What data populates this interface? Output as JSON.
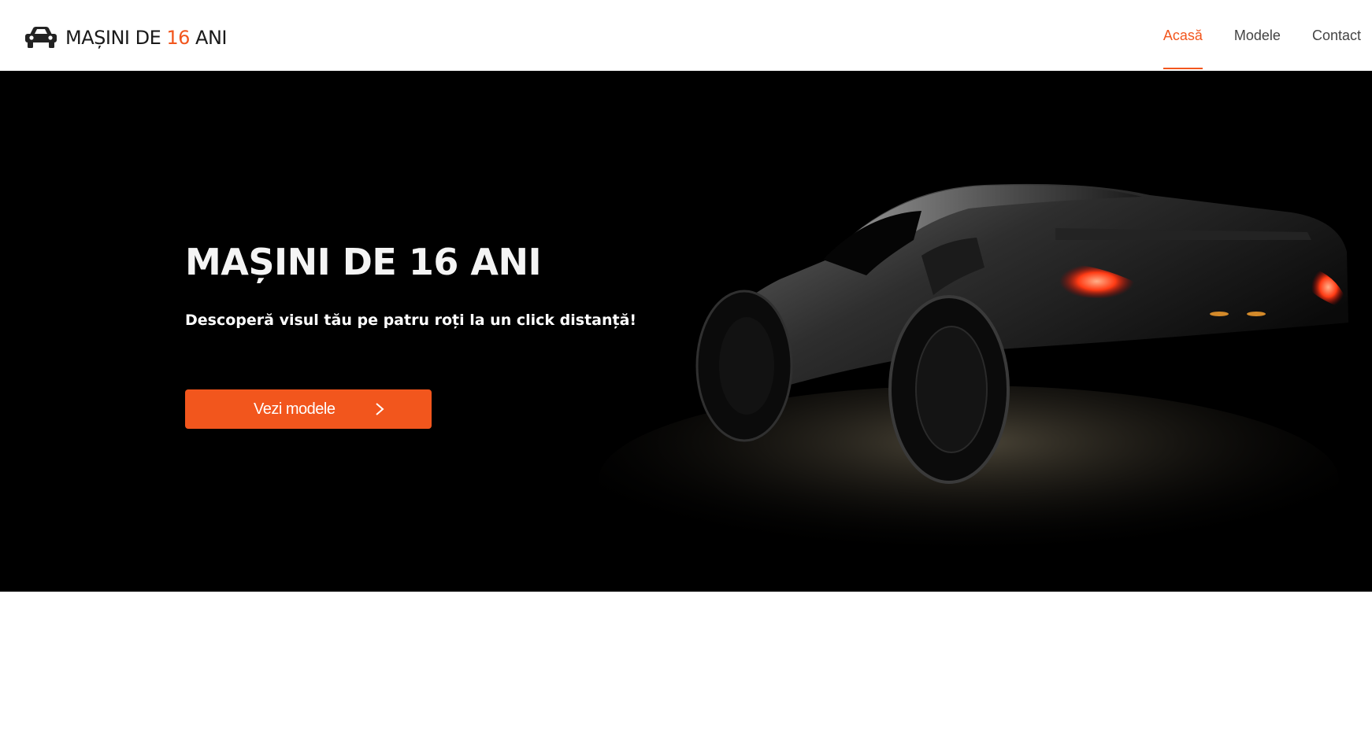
{
  "brand": {
    "icon": "car-icon",
    "text_before": "MAȘINI DE ",
    "text_accent": "16",
    "text_after": " ANI",
    "accent_color": "#f2561d"
  },
  "nav": {
    "items": [
      {
        "label": "Acasă",
        "active": true
      },
      {
        "label": "Modele",
        "active": false
      },
      {
        "label": "Contact",
        "active": false
      }
    ]
  },
  "hero": {
    "title": "MAȘINI DE 16 ANI",
    "subtitle": "Descoperă visul tău pe patru roți la un click distanță!",
    "cta_label": "Vezi modele",
    "cta_icon": "chevron-right-icon",
    "image": "sports-car-night-photo"
  }
}
